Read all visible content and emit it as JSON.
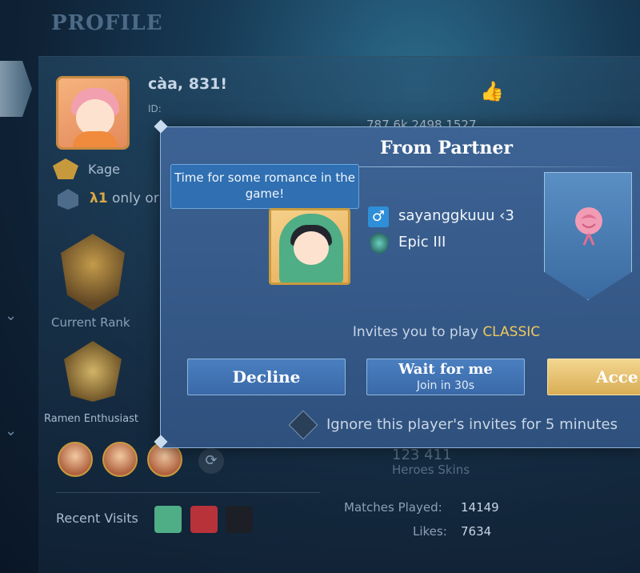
{
  "background": {
    "title": "PROFILE",
    "player_name": "càa, 831!",
    "player_id_label": "ID:",
    "stats_top": "787.6k  2498  1527",
    "rank_title": "Kage",
    "l1_prefix": "λ1",
    "l1_suffix": " only or",
    "current_rank_label": "Current Rank",
    "emblem_label": "Ramen Enthusiast",
    "heroes_skins": "123   411",
    "heroes_skins_labels": "Heroes   Skins",
    "recent_visits_label": "Recent Visits",
    "matches_played_label": "Matches Played:",
    "matches_played_value": "14149",
    "likes_label": "Likes:",
    "likes_value": "7634"
  },
  "modal": {
    "title": "From Partner",
    "bubble_text": "Time for some romance in the game!",
    "partner_name": "sayanggkuuu ‹3",
    "gender_symbol": "♂",
    "partner_rank": "Epic III",
    "invite_prefix": "Invites you to play ",
    "invite_mode": "CLASSIC",
    "decline_label": "Decline",
    "wait_label": "Wait for me",
    "wait_sub": "Join in 30s",
    "accept_label": "Acce",
    "ignore_text": "Ignore this player's invites for 5 minutes"
  },
  "colors": {
    "accent_gold": "#f1c85a",
    "modal_blue": "#3e6496",
    "button_blue": "#4a7fc0"
  }
}
